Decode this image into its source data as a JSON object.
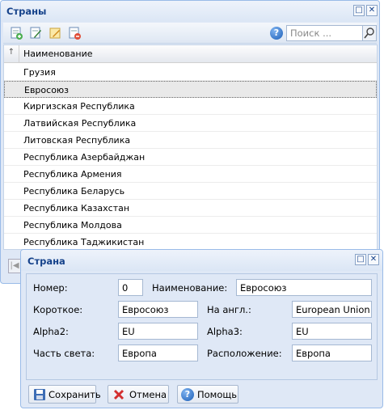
{
  "main_window": {
    "title": "Страны",
    "search_placeholder": "Поиск ...",
    "toolbar_icons": [
      "add-record-icon",
      "edit-record-icon",
      "edit-note-icon",
      "delete-record-icon"
    ],
    "grid": {
      "sort_marker": "↑",
      "column_header": "Наименование",
      "rows": [
        {
          "name": "Грузия",
          "selected": false
        },
        {
          "name": "Евросоюз",
          "selected": true
        },
        {
          "name": "Киргизская Республика",
          "selected": false
        },
        {
          "name": "Латвийская Республика",
          "selected": false
        },
        {
          "name": "Литовская Республика",
          "selected": false
        },
        {
          "name": "Республика Азербайджан",
          "selected": false
        },
        {
          "name": "Республика Армения",
          "selected": false
        },
        {
          "name": "Республика Беларусь",
          "selected": false
        },
        {
          "name": "Республика Казахстан",
          "selected": false
        },
        {
          "name": "Республика Молдова",
          "selected": false
        },
        {
          "name": "Республика Таджикистан",
          "selected": false
        }
      ]
    }
  },
  "dialog": {
    "title": "Страна",
    "form": {
      "number_label": "Номер:",
      "number_value": "0",
      "name_label": "Наименование:",
      "name_value": "Евросоюз",
      "short_label": "Короткое:",
      "short_value": "Евросоюз",
      "english_label": "На англ.:",
      "english_value": "European Union",
      "alpha2_label": "Alpha2:",
      "alpha2_value": "EU",
      "alpha3_label": "Alpha3:",
      "alpha3_value": "EU",
      "part_label": "Часть света:",
      "part_value": "Европа",
      "location_label": "Расположение:",
      "location_value": "Европа"
    },
    "buttons": {
      "save": "Сохранить",
      "cancel": "Отмена",
      "help": "Помощь"
    }
  },
  "colors": {
    "title_text": "#15428b",
    "window_bg": "#dfe8f6",
    "window_border": "#99bbe8"
  }
}
